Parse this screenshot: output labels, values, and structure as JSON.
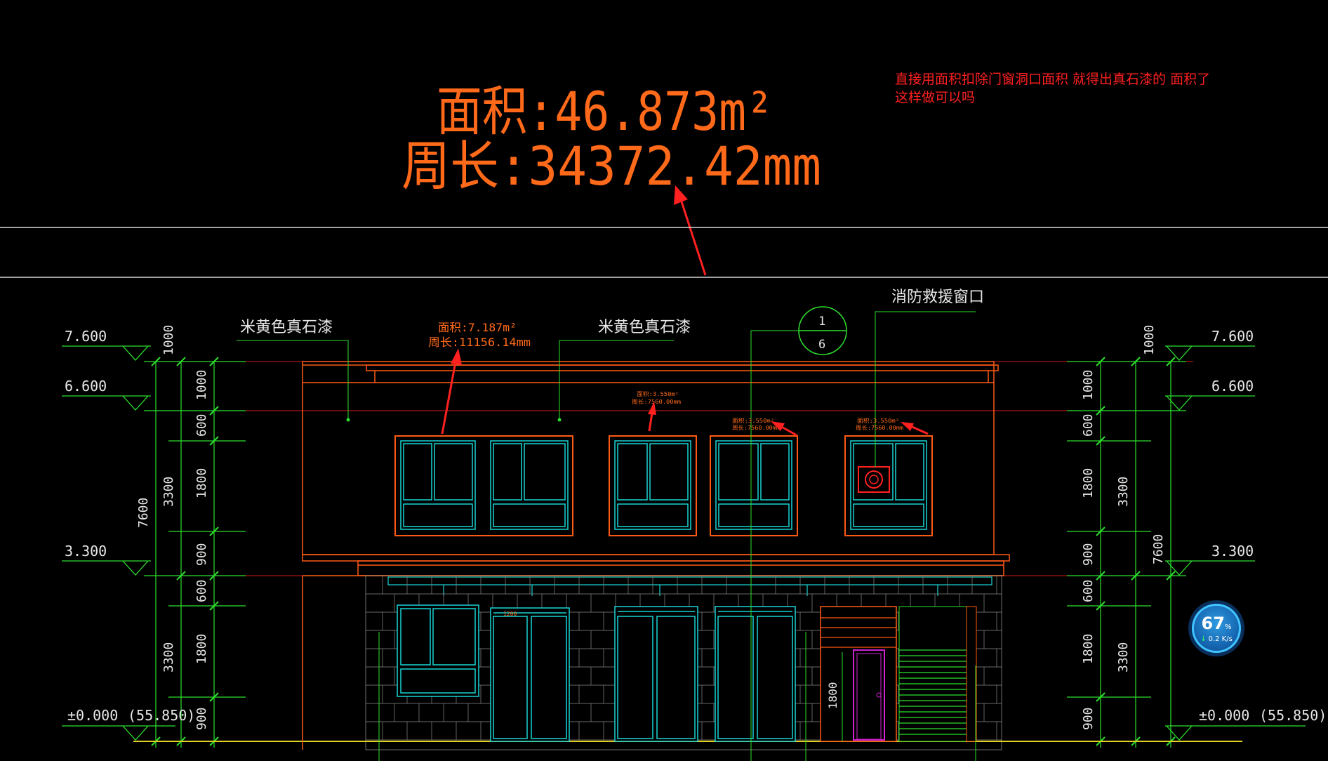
{
  "measure_main": {
    "area": "面积:46.873m²",
    "perimeter": "周长:34372.42mm"
  },
  "note": {
    "line1": "直接用面积扣除门窗洞口面积 就得出真石漆的 面积了",
    "line2": "这样做可以吗"
  },
  "labels": {
    "paint_left": "米黄色真石漆",
    "paint_right": "米黄色真石漆",
    "fire_window": "消防救援窗口",
    "section_top": "1",
    "section_bottom": "6"
  },
  "measure_small": {
    "area": "面积:7.187m²",
    "perimeter": "周长:11156.14mm"
  },
  "measure_tiny": [
    {
      "area": "面积:3.550m²",
      "perimeter": "周长:7560.00mm"
    },
    {
      "area": "面积:3.550m²",
      "perimeter": "周长:7560.00mm"
    },
    {
      "area": "面积:3.550m²",
      "perimeter": "周长:7560.00mm"
    }
  ],
  "elevations": {
    "left": [
      "7.600",
      "6.600",
      "3.300",
      "±0.000",
      "(55.850)"
    ],
    "right": [
      "7.600",
      "6.600",
      "3.300",
      "±0.000",
      "(55.850)"
    ]
  },
  "dimensions": {
    "outer": "7600",
    "floor_upper": "3300",
    "floor_lower": "3300",
    "parapet": "1000",
    "segments": [
      "1000",
      "600",
      "1800",
      "900",
      "600",
      "1800",
      "900"
    ],
    "door_height": "1800",
    "door_tag": "1200"
  },
  "network_widget": {
    "percent": "67",
    "percent_unit": "%",
    "speed": "0.2 K/s"
  },
  "colors": {
    "background": "#000000",
    "measure": "#ff6a1a",
    "dimension": "#2de02d",
    "window": "#19d4d4",
    "wall": "#ff5a14",
    "annotation": "#ff2020",
    "door": "#d020d0"
  }
}
